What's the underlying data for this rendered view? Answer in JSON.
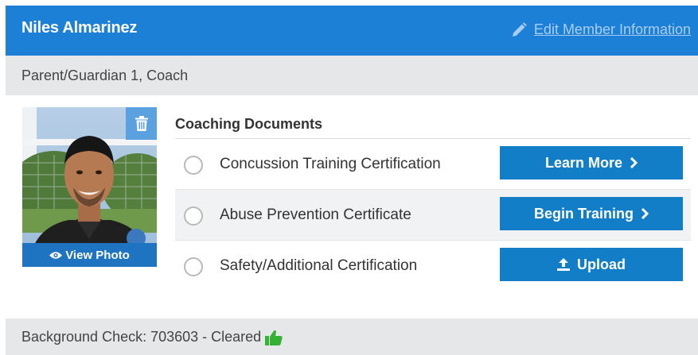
{
  "member": {
    "name": "Niles Almarinez",
    "edit_label": "Edit Member Information",
    "roles": "Parent/Guardian 1, Coach"
  },
  "photo": {
    "view_label": "View Photo"
  },
  "documents": {
    "title": "Coaching Documents",
    "items": [
      {
        "label": "Concussion Training Certification",
        "button": "Learn More",
        "button_icon": "chevron-right-icon"
      },
      {
        "label": "Abuse Prevention Certificate",
        "button": "Begin Training",
        "button_icon": "chevron-right-icon"
      },
      {
        "label": "Safety/Additional Certification",
        "button": "Upload",
        "button_icon": "upload-icon"
      }
    ]
  },
  "background_check": {
    "text": "Background Check: 703603 - Cleared",
    "status_icon": "thumbs-up-icon"
  },
  "colors": {
    "header": "#1c80d6",
    "button": "#137ec8",
    "status_green": "#34b233"
  }
}
